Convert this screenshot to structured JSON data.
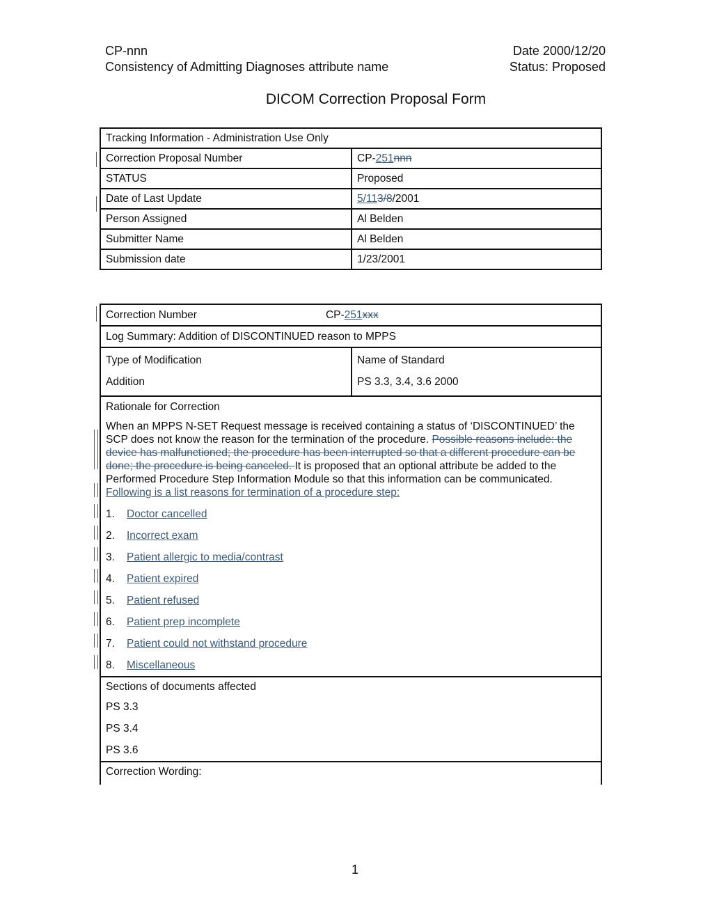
{
  "header": {
    "doc_id": "CP-nnn",
    "date": "Date 2000/12/20",
    "subject": "Consistency of Admitting Diagnoses attribute name",
    "status": "Status: Proposed"
  },
  "title": "DICOM Correction Proposal Form",
  "tracking": {
    "heading": "Tracking Information - Administration Use Only",
    "rows": [
      {
        "label": "Correction Proposal Number",
        "value_prefix": "CP-",
        "value_inserted": "251",
        "value_deleted": "nnn",
        "value_suffix": ""
      },
      {
        "label": "STATUS",
        "value": "Proposed"
      },
      {
        "label": "Date of Last Update",
        "value_prefix": "",
        "value_inserted": "5/11",
        "value_deleted": "3/8",
        "value_suffix": "/2001"
      },
      {
        "label": "Person Assigned",
        "value": "Al Belden"
      },
      {
        "label": "Submitter Name",
        "value": "Al Belden"
      },
      {
        "label": "Submission date",
        "value": "1/23/2001"
      }
    ]
  },
  "correction": {
    "number_label": "Correction Number",
    "number_prefix": "CP-",
    "number_inserted": "251",
    "number_deleted": "xxx",
    "log_summary": "Log Summary: Addition of DISCONTINUED reason to MPPS",
    "type_label": "Type of Modification",
    "type_value": "Addition",
    "standard_label": "Name of Standard",
    "standard_value": "PS 3.3, 3.4, 3.6 2000",
    "rationale_label": "Rationale for Correction",
    "rationale_text_1": "When an MPPS N-SET Request message is received containing a status of ‘DISCONTINUED’ the SCP does not know the reason for the termination of the procedure. ",
    "rationale_deleted": "Possible reasons include: the device has malfunctioned; the procedure has been interrupted so that a different procedure can be done; the procedure is being canceled. ",
    "rationale_text_2": "It is proposed that an optional attribute be added to the Performed Procedure Step Information Module so that this information can be communicated.",
    "rationale_inserted": " Following is a list reasons for termination of a procedure step:",
    "reasons": [
      {
        "num": "1.",
        "text": "Doctor cancelled"
      },
      {
        "num": "2.",
        "text": "Incorrect exam"
      },
      {
        "num": "3.",
        "text": "Patient allergic to media/contrast"
      },
      {
        "num": "4.",
        "text": "Patient expired"
      },
      {
        "num": "5.",
        "text": "Patient refused"
      },
      {
        "num": "6.",
        "text": "Patient prep incomplete"
      },
      {
        "num": "7.",
        "text": "Patient could not withstand procedure"
      },
      {
        "num": "8.",
        "text": "Miscellaneous"
      }
    ],
    "sections_label": "Sections of documents affected",
    "sections": [
      "PS 3.3",
      "PS 3.4",
      "PS 3.6"
    ],
    "wording_label": "Correction Wording:"
  },
  "page_number": "1",
  "colors": {
    "revision": "#3d5a75",
    "text": "#111111"
  }
}
